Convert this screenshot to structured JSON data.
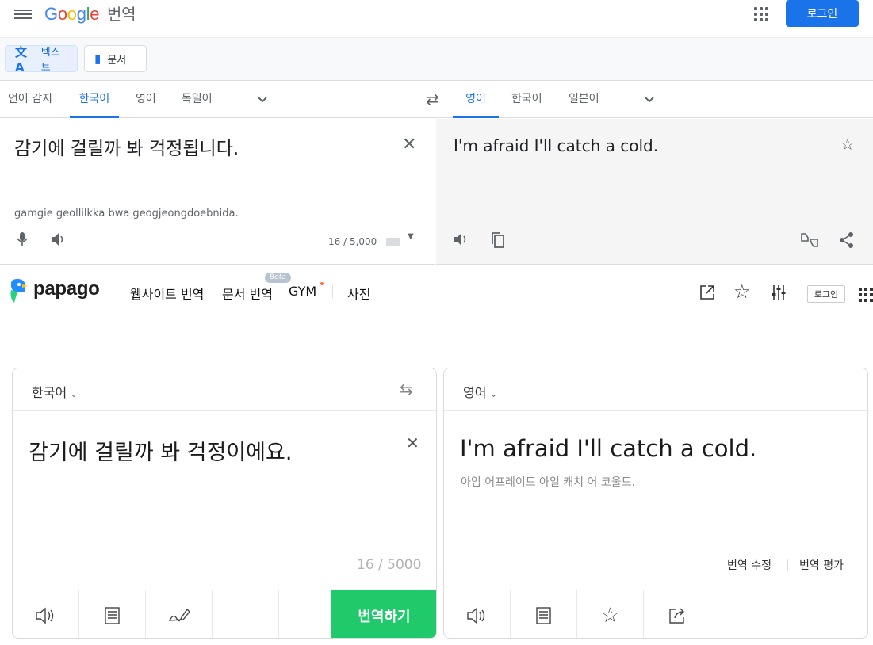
{
  "google": {
    "logo_letters": [
      "G",
      "o",
      "o",
      "g",
      "l",
      "e"
    ],
    "logo_suffix": "번역",
    "login": "로그인",
    "modes": {
      "text": "텍스트",
      "docs": "문서"
    },
    "src_langs": [
      "언어 감지",
      "한국어",
      "영어",
      "독일어"
    ],
    "src_active": "한국어",
    "tgt_langs": [
      "영어",
      "한국어",
      "일본어"
    ],
    "tgt_active": "영어",
    "source_text": "감기에 걸릴까 봐 걱정됩니다.",
    "romanization": "gamgie geollilkka bwa geogjeongdoebnida.",
    "char_count": "16 / 5,000",
    "translation": "I'm afraid I'll catch a cold.",
    "colors": {
      "accent": "#1a73e8",
      "login_bg": "#1a73e8",
      "target_bg": "#f5f5f5"
    },
    "icons": [
      "menu-icon",
      "apps-icon",
      "translate-icon",
      "document-icon",
      "swap-icon",
      "close-icon",
      "mic-icon",
      "speaker-icon",
      "keyboard-icon",
      "star-icon",
      "copy-icon",
      "feedback-icon",
      "share-icon"
    ]
  },
  "papago": {
    "logo_text": "papago",
    "nav": [
      "웹사이트 번역",
      "문서 번역",
      "GYM",
      "사전"
    ],
    "beta": "Beta",
    "login": "로그인",
    "src_lang": "한국어",
    "tgt_lang": "영어",
    "source_text": "감기에 걸릴까 봐 걱정이에요.",
    "char_count": "16 / 5000",
    "translation": "I'm afraid I'll catch a cold.",
    "pronunciation": "아임 어프레이드 아일 캐치 어 코울드.",
    "edit_label": "번역 수정",
    "eval_label": "번역 평가",
    "translate_button": "번역하기",
    "colors": {
      "translate_button": "#20c96a",
      "logo_blue": "#1f8cff",
      "logo_green": "#28d17c"
    },
    "icons": [
      "open-external-icon",
      "star-icon",
      "settings-icon",
      "apps-icon",
      "swap-icon",
      "close-icon",
      "speaker-icon",
      "vocabulary-icon",
      "handwriting-icon",
      "share-icon"
    ]
  }
}
